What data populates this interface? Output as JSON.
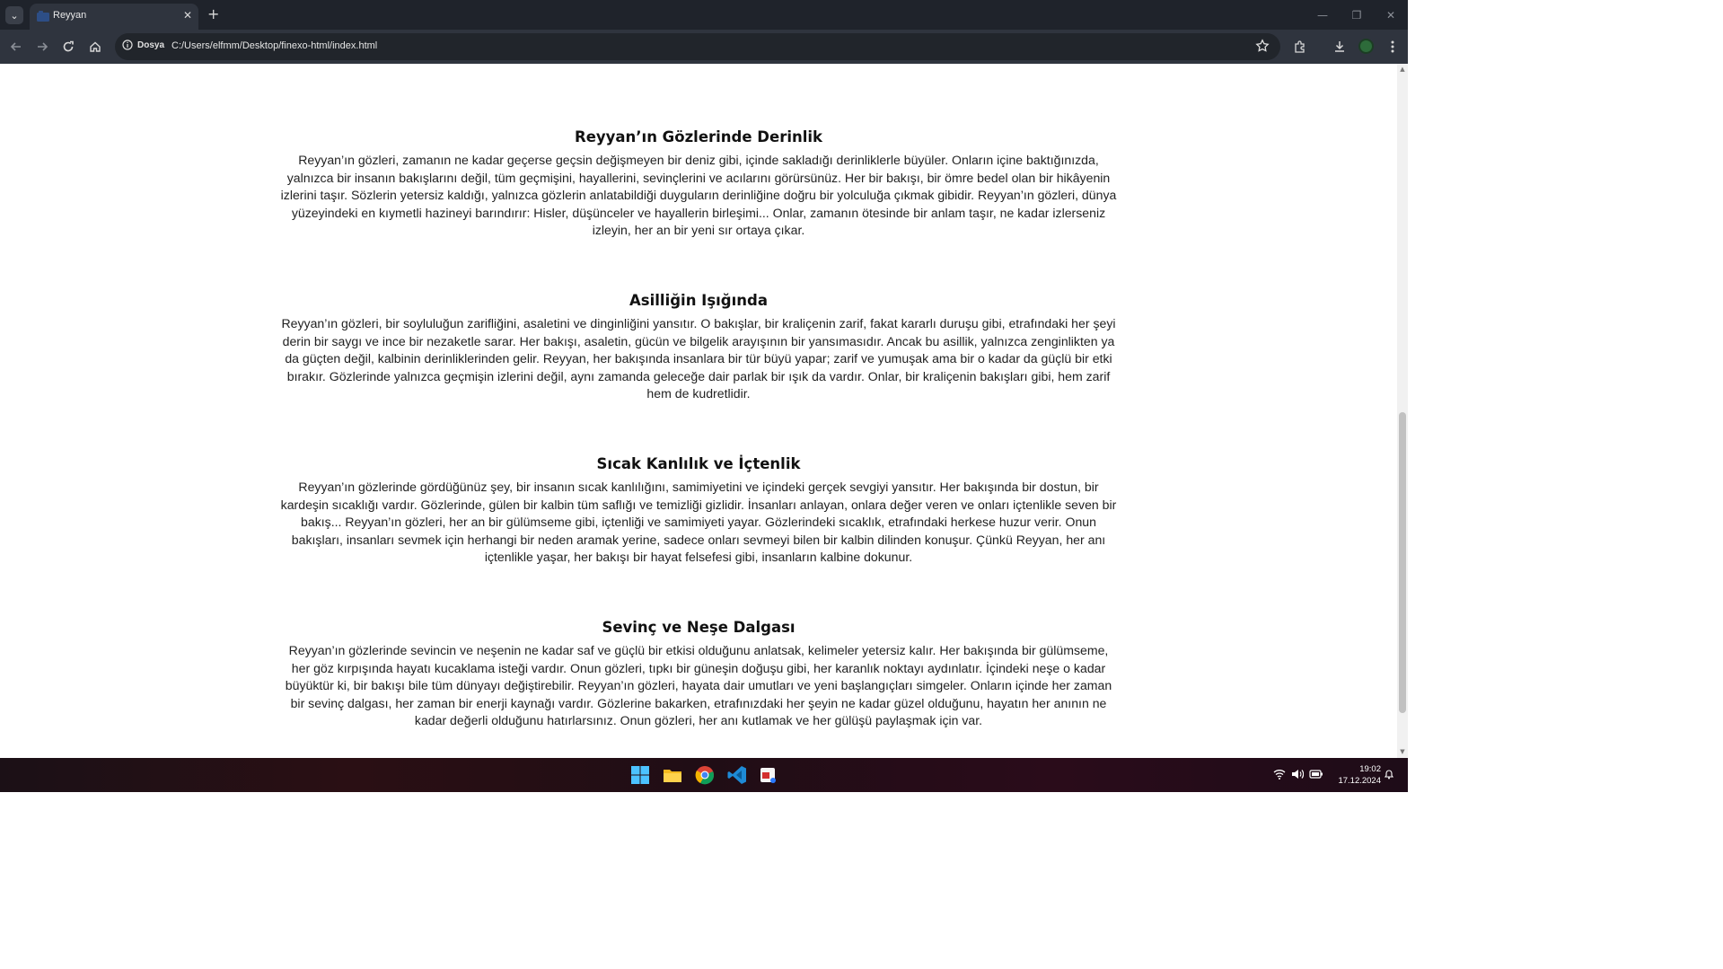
{
  "browser": {
    "tab_title": "Reyyan",
    "site_info_label": "Dosya",
    "url": "C:/Users/elfmm/Desktop/finexo-html/index.html"
  },
  "sections": [
    {
      "title": "Reyyan’ın Gözlerinde Derinlik",
      "body": "Reyyan’ın gözleri, zamanın ne kadar geçerse geçsin değişmeyen bir deniz gibi, içinde sakladığı derinliklerle büyüler. Onların içine baktığınızda, yalnızca bir insanın bakışlarını değil, tüm geçmişini, hayallerini, sevinçlerini ve acılarını görürsünüz. Her bir bakışı, bir ömre bedel olan bir hikâyenin izlerini taşır. Sözlerin yetersiz kaldığı, yalnızca gözlerin anlatabildiği duyguların derinliğine doğru bir yolculuğa çıkmak gibidir. Reyyan’ın gözleri, dünya yüzeyindeki en kıymetli hazineyi barındırır: Hisler, düşünceler ve hayallerin birleşimi... Onlar, zamanın ötesinde bir anlam taşır, ne kadar izlerseniz izleyin, her an bir yeni sır ortaya çıkar."
    },
    {
      "title": "Asilliğin Işığında",
      "body": "Reyyan’ın gözleri, bir soyluluğun zarifliğini, asaletini ve dinginliğini yansıtır. O bakışlar, bir kraliçenin zarif, fakat kararlı duruşu gibi, etrafındaki her şeyi derin bir saygı ve ince bir nezaketle sarar. Her bakışı, asaletin, gücün ve bilgelik arayışının bir yansımasıdır. Ancak bu asillik, yalnızca zenginlikten ya da güçten değil, kalbinin derinliklerinden gelir. Reyyan, her bakışında insanlara bir tür büyü yapar; zarif ve yumuşak ama bir o kadar da güçlü bir etki bırakır. Gözlerinde yalnızca geçmişin izlerini değil, aynı zamanda geleceğe dair parlak bir ışık da vardır. Onlar, bir kraliçenin bakışları gibi, hem zarif hem de kudretlidir."
    },
    {
      "title": "Sıcak Kanlılık ve İçtenlik",
      "body": "Reyyan’ın gözlerinde gördüğünüz şey, bir insanın sıcak kanlılığını, samimiyetini ve içindeki gerçek sevgiyi yansıtır. Her bakışında bir dostun, bir kardeşin sıcaklığı vardır. Gözlerinde, gülen bir kalbin tüm saflığı ve temizliği gizlidir. İnsanları anlayan, onlara değer veren ve onları içtenlikle seven bir bakış... Reyyan’ın gözleri, her an bir gülümseme gibi, içtenliği ve samimiyeti yayar. Gözlerindeki sıcaklık, etrafındaki herkese huzur verir. Onun bakışları, insanları sevmek için herhangi bir neden aramak yerine, sadece onları sevmeyi bilen bir kalbin dilinden konuşur. Çünkü Reyyan, her anı içtenlikle yaşar, her bakışı bir hayat felsefesi gibi, insanların kalbine dokunur."
    },
    {
      "title": "Sevinç ve Neşe Dalgası",
      "body": "Reyyan’ın gözlerinde sevincin ve neşenin ne kadar saf ve güçlü bir etkisi olduğunu anlatsak, kelimeler yetersiz kalır. Her bakışında bir gülümseme, her göz kırpışında hayatı kucaklama isteği vardır. Onun gözleri, tıpkı bir güneşin doğuşu gibi, her karanlık noktayı aydınlatır. İçindeki neşe o kadar büyüktür ki, bir bakışı bile tüm dünyayı değiştirebilir. Reyyan’ın gözleri, hayata dair umutları ve yeni başlangıçları simgeler. Onların içinde her zaman bir sevinç dalgası, her zaman bir enerji kaynağı vardır. Gözlerine bakarken, etrafınızdaki her şeyin ne kadar güzel olduğunu, hayatın her anının ne kadar değerli olduğunu hatırlarsınız. Onun gözleri, her anı kutlamak ve her gülüşü paylaşmak için var."
    }
  ],
  "taskbar": {
    "time": "19:02",
    "date": "17.12.2024"
  },
  "icons": [
    "tab-list-icon",
    "close-icon",
    "plus-icon",
    "back-icon",
    "forward-icon",
    "reload-icon",
    "home-icon",
    "info-icon",
    "star-icon",
    "extensions-icon",
    "download-icon",
    "menu-icon",
    "windows-start-icon",
    "file-explorer-icon",
    "chrome-icon",
    "vscode-icon",
    "app-icon",
    "wifi-icon",
    "volume-icon",
    "battery-icon",
    "notification-icon"
  ],
  "colors": {
    "chrome_dark": "#1f232b",
    "toolbar": "#2f343e",
    "page_bg": "#ffffff",
    "text": "#222222"
  }
}
